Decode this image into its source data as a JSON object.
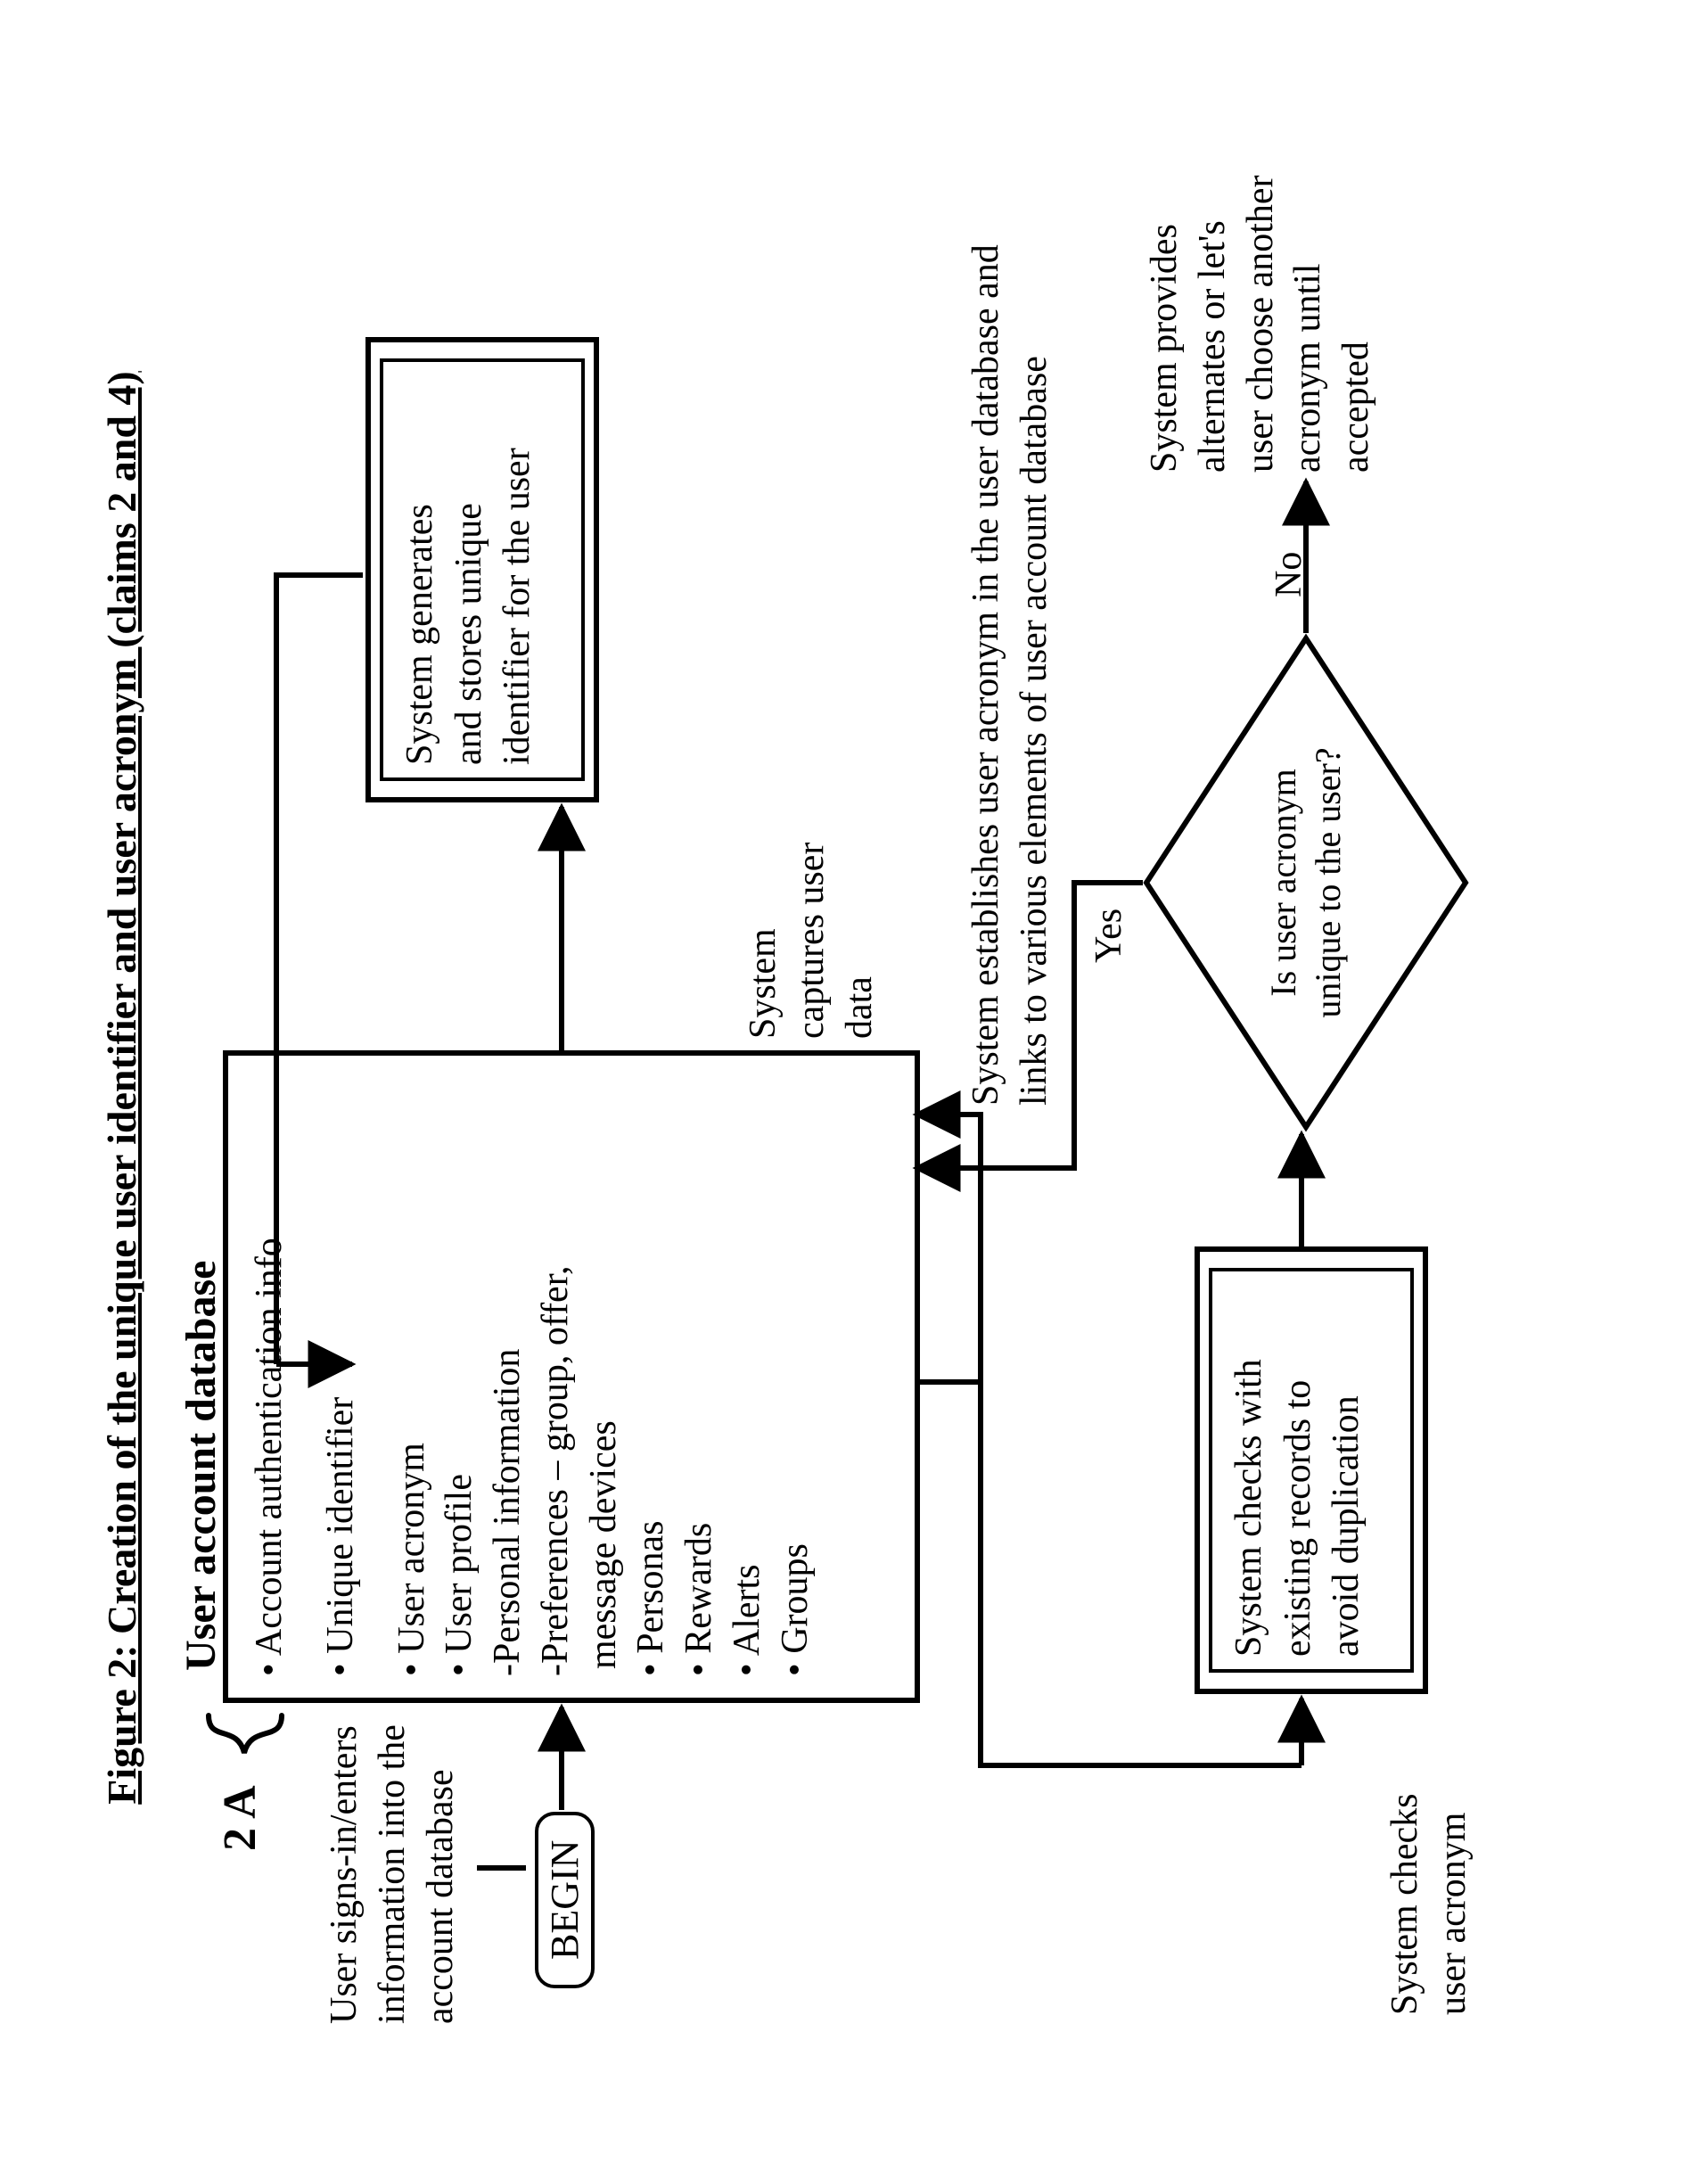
{
  "title": "Figure 2: Creation of the unique user identifier and user acronym (claims 2 and 4)",
  "tag": "2 A",
  "begin": "BEGIN",
  "signin": {
    "l1": "User signs-in/enters",
    "l2": "information into the",
    "l3": "account database"
  },
  "db": {
    "heading": "User account database",
    "i0": "• Account authentication info",
    "i1": "• Unique identifier",
    "i2": "• User acronym",
    "i3": "• User profile",
    "i4": "-Personal information",
    "i5": "-Preferences – group, offer,",
    "i6": "message devices",
    "i7": "• Personas",
    "i8": "• Rewards",
    "i9": "• Alerts",
    "i10": "• Groups"
  },
  "capture": {
    "l1": "System",
    "l2": "captures user",
    "l3": "data"
  },
  "uid": {
    "l1": "System generates",
    "l2": "and stores unique",
    "l3": "identifier for the user"
  },
  "establish": {
    "l1": "System establishes user acronym in the user database and",
    "l2": "links to various elements of user account database"
  },
  "check_label": {
    "l1": "System checks",
    "l2": "user acronym"
  },
  "check_box": {
    "l1": "System checks with",
    "l2": "existing records to",
    "l3": "avoid duplication"
  },
  "decision": {
    "l1": "Is user acronym",
    "l2": "unique to the user?"
  },
  "yes": "Yes",
  "no": "No",
  "alt": {
    "l1": "System provides",
    "l2": "alternates or let's",
    "l3": "user choose another",
    "l4": "acronym until",
    "l5": "accepted"
  }
}
